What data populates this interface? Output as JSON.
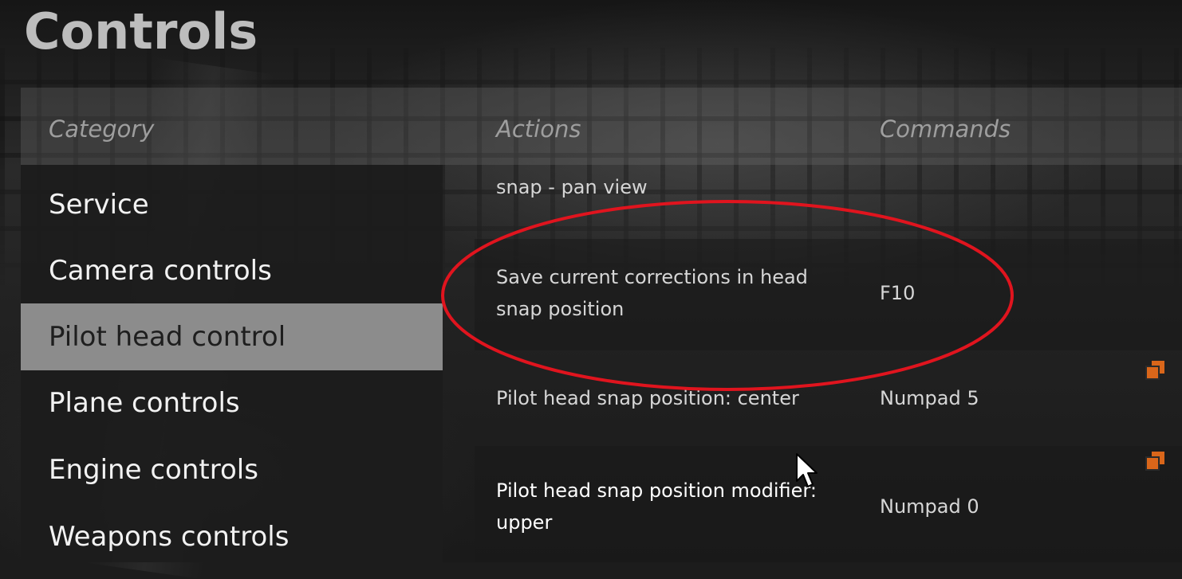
{
  "page": {
    "title": "Controls"
  },
  "columns": {
    "category": "Category",
    "actions": "Actions",
    "commands": "Commands"
  },
  "categories": [
    {
      "label": "Service",
      "selected": false
    },
    {
      "label": "Camera controls",
      "selected": false
    },
    {
      "label": "Pilot head control",
      "selected": true
    },
    {
      "label": "Plane controls",
      "selected": false
    },
    {
      "label": "Engine controls",
      "selected": false
    },
    {
      "label": "Weapons controls",
      "selected": false
    }
  ],
  "actions": [
    {
      "label": "snap - pan view",
      "command": ""
    },
    {
      "label": "Save current corrections in head snap position",
      "command": "F10"
    },
    {
      "label": "Pilot head snap position: center",
      "command": "Numpad 5"
    },
    {
      "label": "Pilot head snap position modifier: upper",
      "command": "Numpad 0"
    }
  ],
  "colors": {
    "accent_orange": "#d9661a",
    "annotation_red": "#e0141e",
    "selected_category_bg": "#8c8c8c"
  },
  "icons": {
    "link": "external-link-icon",
    "pointer": "mouse-pointer-icon"
  }
}
